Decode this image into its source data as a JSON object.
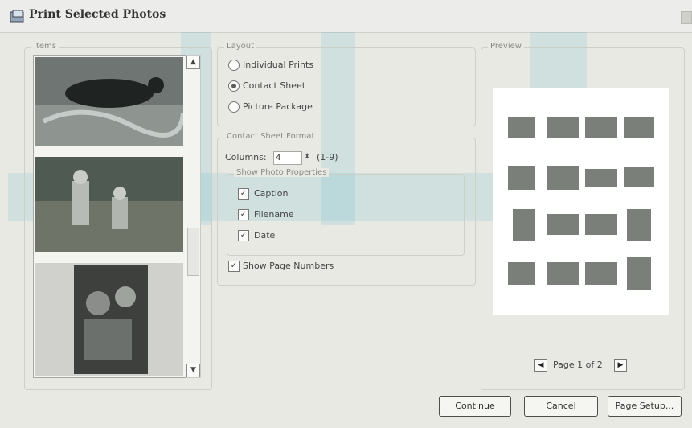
{
  "window": {
    "title": "Print Selected Photos"
  },
  "items": {
    "label": "Items"
  },
  "layout": {
    "label": "Layout",
    "options": [
      "Individual Prints",
      "Contact Sheet",
      "Picture Package"
    ],
    "selected": "Contact Sheet"
  },
  "contact_sheet": {
    "label": "Contact Sheet Format",
    "columns_label": "Columns:",
    "columns_value": "4",
    "columns_range": "(1-9)",
    "show_props_label": "Show Photo Properties",
    "props": [
      {
        "label": "Caption",
        "checked": true
      },
      {
        "label": "Filename",
        "checked": true
      },
      {
        "label": "Date",
        "checked": true
      }
    ],
    "show_page_numbers": {
      "label": "Show Page Numbers",
      "checked": true
    }
  },
  "preview": {
    "label": "Preview",
    "page_text": "Page 1 of 2"
  },
  "buttons": {
    "continue": "Continue",
    "cancel": "Cancel",
    "page_setup": "Page Setup..."
  },
  "icons": {
    "prev": "chevron-left-icon",
    "next": "chevron-right-icon",
    "scroll_up": "chevron-up-icon",
    "scroll_down": "chevron-down-icon",
    "app": "print-photos-icon",
    "check": "checkmark-icon"
  },
  "colors": {
    "watermark": "#5fb8c9",
    "background": "#e9e9e4"
  }
}
